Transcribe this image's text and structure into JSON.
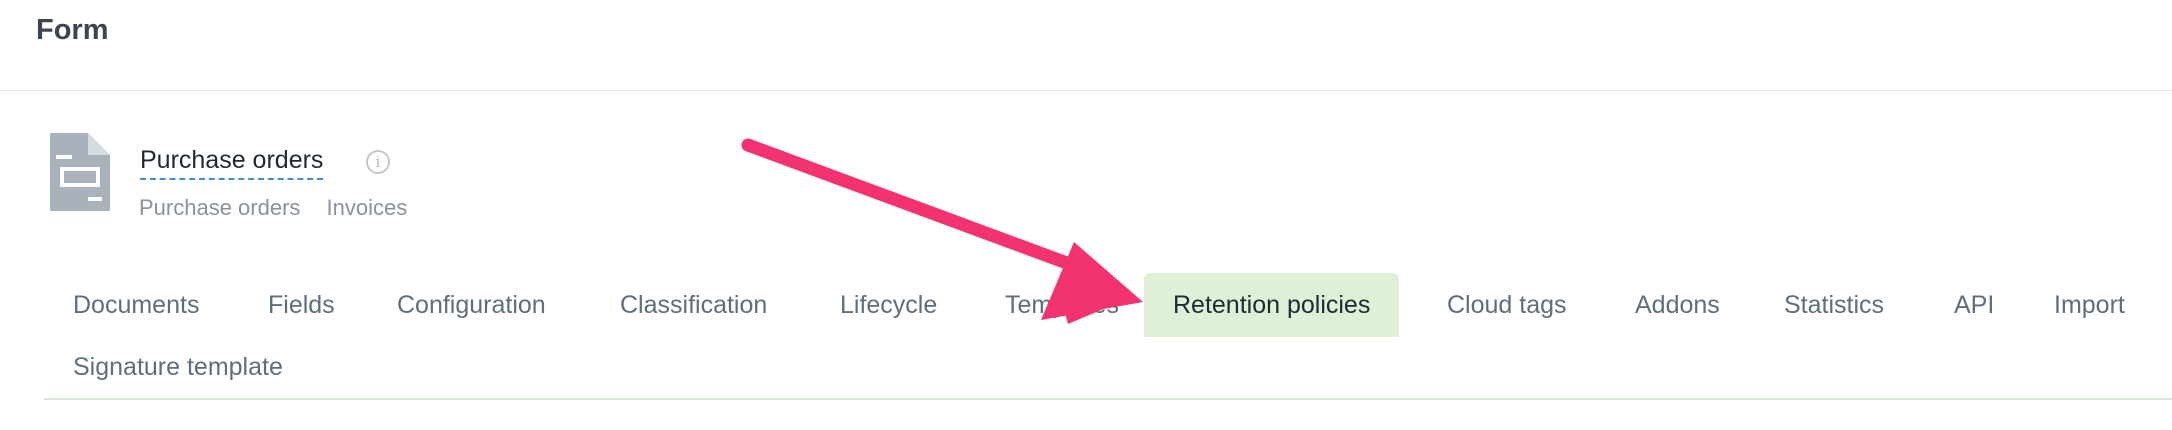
{
  "header": {
    "title": "Form"
  },
  "form": {
    "name": "Purchase orders",
    "breadcrumbs": [
      "Purchase orders",
      "Invoices"
    ]
  },
  "tabs": [
    {
      "label": "Documents"
    },
    {
      "label": "Fields"
    },
    {
      "label": "Configuration"
    },
    {
      "label": "Classification"
    },
    {
      "label": "Lifecycle"
    },
    {
      "label": "Templates"
    },
    {
      "label": "Retention policies",
      "active": true
    },
    {
      "label": "Cloud tags"
    },
    {
      "label": "Addons"
    },
    {
      "label": "Statistics"
    },
    {
      "label": "API"
    },
    {
      "label": "Import"
    },
    {
      "label": "Signature template"
    }
  ],
  "colors": {
    "active_tab_bg": "#dff0d6",
    "annotation_arrow": "#f2336f",
    "link_underline": "#3c8fd8"
  },
  "icons": {
    "form": "document-form-icon",
    "info": "info-circle-icon"
  }
}
